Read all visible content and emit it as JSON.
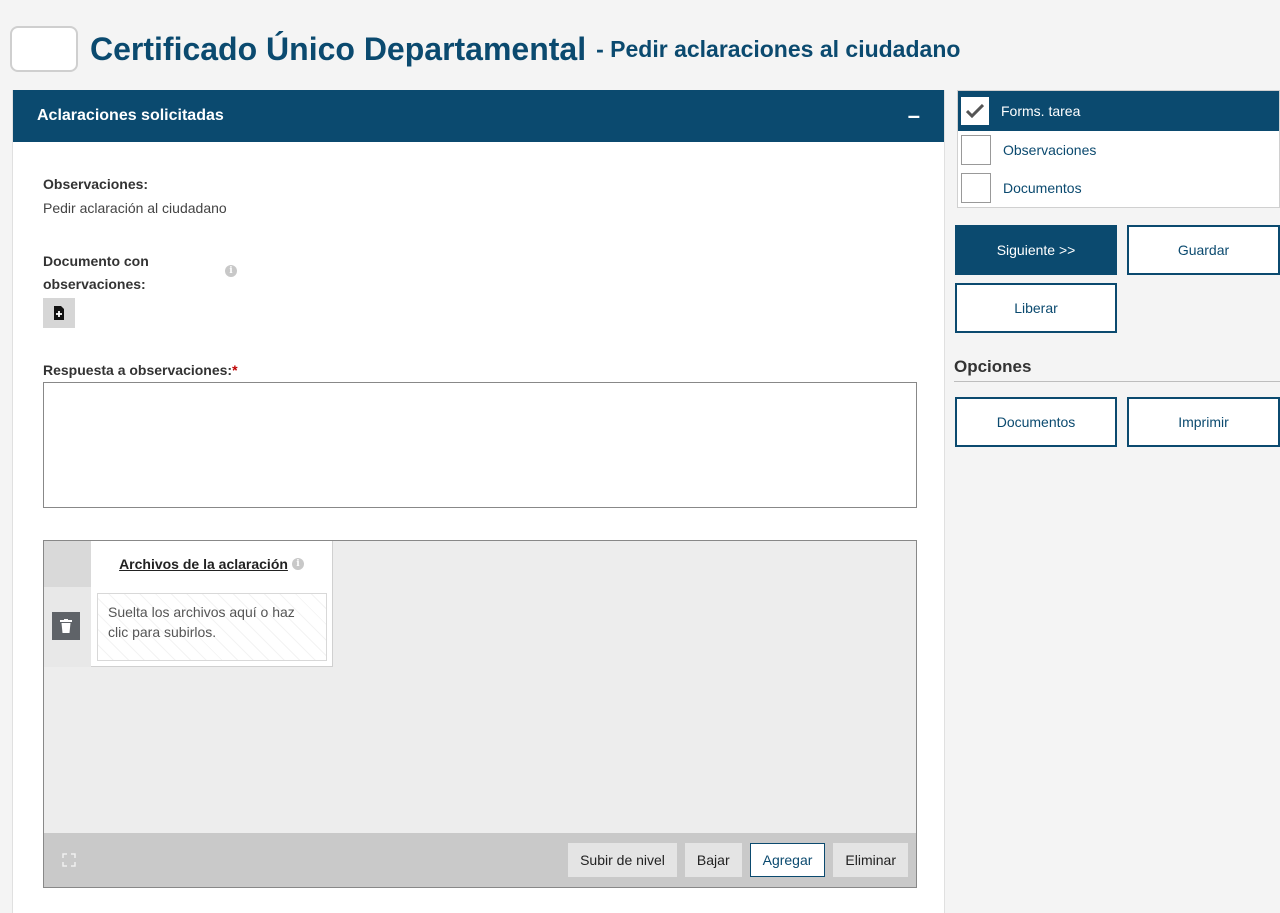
{
  "header": {
    "title": "Certificado Único Departamental",
    "subtitle": "- Pedir aclaraciones al ciudadano"
  },
  "panel": {
    "title": "Aclaraciones solicitadas",
    "collapse_symbol": "–",
    "observaciones_label": "Observaciones:",
    "observaciones_value": "Pedir aclaración al ciudadano",
    "documento_label_line1": "Documento con",
    "documento_label_line2": "observaciones:",
    "respuesta_label": "Respuesta a observaciones:",
    "required_mark": "*",
    "respuesta_value": ""
  },
  "grid": {
    "column_header": "Archivos de la aclaración",
    "drop_text": "Suelta los archivos aquí o haz clic para subirlos.",
    "buttons": {
      "subir": "Subir de nivel",
      "bajar": "Bajar",
      "agregar": "Agregar",
      "eliminar": "Eliminar"
    }
  },
  "sidebar": {
    "tabs": [
      {
        "label": "Forms. tarea",
        "checked": true
      },
      {
        "label": "Observaciones",
        "checked": false
      },
      {
        "label": "Documentos",
        "checked": false
      }
    ],
    "actions": {
      "siguiente": "Siguiente >>",
      "guardar": "Guardar",
      "liberar": "Liberar"
    },
    "options_title": "Opciones",
    "options": {
      "documentos": "Documentos",
      "imprimir": "Imprimir"
    }
  },
  "colors": {
    "primary": "#0b4a6f",
    "required": "#c00000"
  },
  "icons": {
    "info": "info-icon",
    "add_document": "add-document-icon",
    "trash": "trash-icon",
    "fullscreen": "fullscreen-icon",
    "check": "check-icon"
  }
}
